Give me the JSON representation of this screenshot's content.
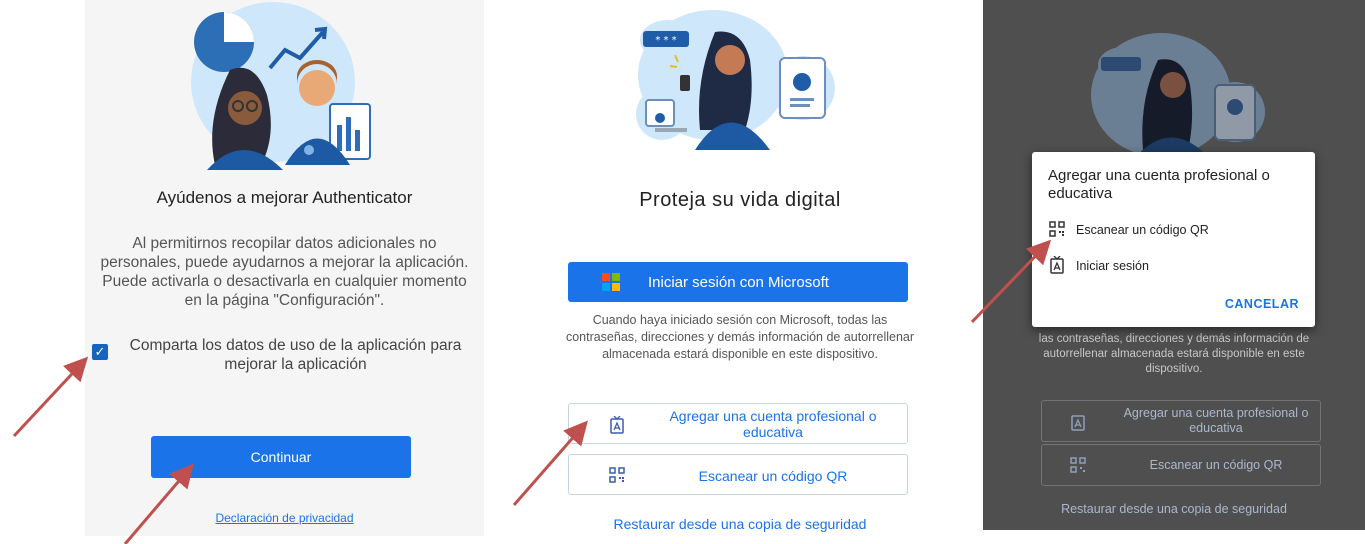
{
  "panel1": {
    "title": "Ayúdenos a mejorar Authenticator",
    "description": "Al permitirnos recopilar datos adicionales no personales, puede ayudarnos a mejorar la aplicación. Puede activarla o desactivarla en cualquier momento en la página \"Configuración\".",
    "checkbox_label": "Comparta los datos de uso de la aplicación para mejorar la aplicación",
    "checkbox_checked": true,
    "continue_label": "Continuar",
    "privacy_link": "Declaración de privacidad"
  },
  "panel2": {
    "title": "Proteja su vida digital",
    "ms_signin_label": "Iniciar sesión con Microsoft",
    "note": "Cuando haya iniciado sesión con Microsoft, todas las contraseñas, direcciones y demás información de autorrellenar almacenada estará disponible en este dispositivo.",
    "work_account_label": "Agregar una cuenta profesional o educativa",
    "scan_qr_label": "Escanear un código QR",
    "restore_label": "Restaurar desde una copia de seguridad"
  },
  "panel3": {
    "bg_note": "las contraseñas, direcciones y demás información de autorrellenar almacenada estará disponible en este dispositivo.",
    "bg_work_label": "Agregar una cuenta profesional o educativa",
    "bg_qr_label": "Escanear un código QR",
    "bg_restore_label": "Restaurar desde una copia de seguridad",
    "dialog": {
      "title": "Agregar una cuenta profesional o educativa",
      "items": [
        {
          "label": "Escanear un código QR",
          "icon": "qr-code-icon"
        },
        {
          "label": "Iniciar sesión",
          "icon": "badge-icon"
        }
      ],
      "cancel_label": "CANCELAR"
    }
  },
  "colors": {
    "primary_blue": "#1a73e8",
    "arrow_red": "#c0504d",
    "panel1_bg": "#f5f5f5",
    "panel3_dim_bg": "#4f4f4f"
  }
}
